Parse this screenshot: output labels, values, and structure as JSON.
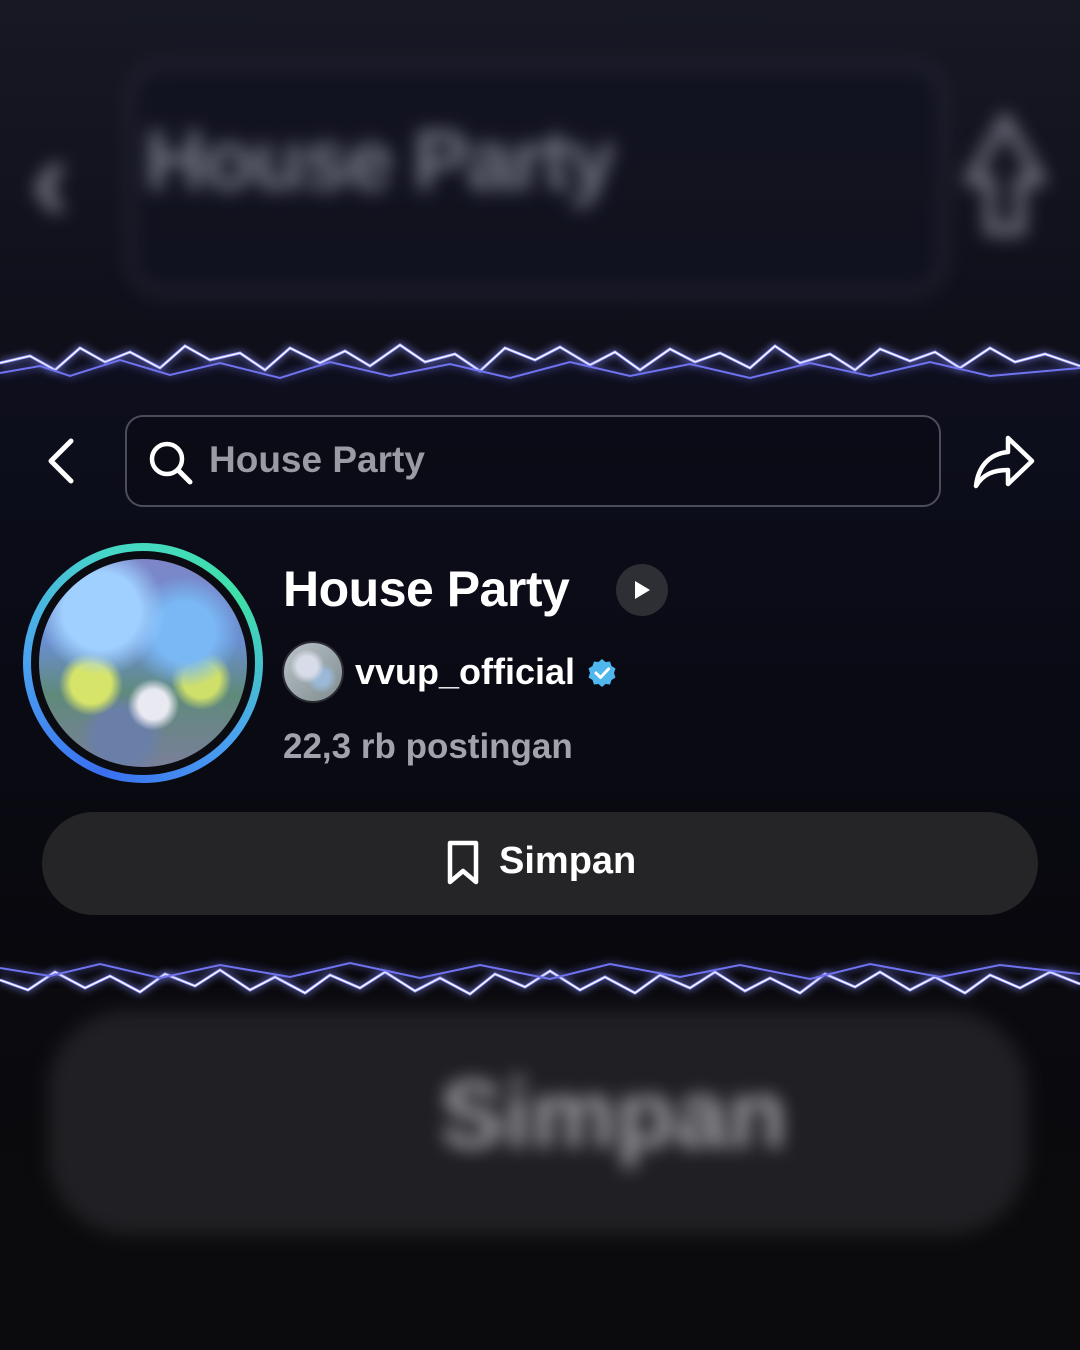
{
  "search": {
    "query": "House Party"
  },
  "playlist": {
    "title": "House Party",
    "author": "vvup_official",
    "verified": true,
    "post_count": "22,3 rb postingan"
  },
  "actions": {
    "save_label": "Simpan"
  },
  "background": {
    "search_query": "House Party",
    "save_label": "Simpan"
  },
  "icons": {
    "back": "chevron-left-icon",
    "search": "search-icon",
    "share": "share-icon",
    "play": "play-icon",
    "verified": "verified-badge-icon",
    "save": "bookmark-icon"
  },
  "colors": {
    "verified": "#4fb6ee",
    "ring_start": "#3a6ff0",
    "ring_end": "#3fe0a8"
  }
}
